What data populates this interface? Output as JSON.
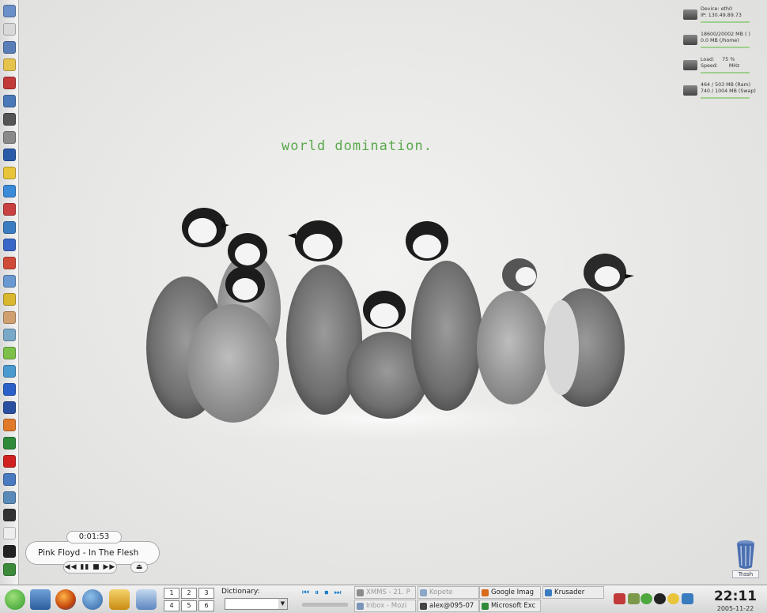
{
  "desktop": {
    "tagline": "world domination.",
    "trash_label": "Trash"
  },
  "sysmon": [
    {
      "icon": "network-card-icon",
      "text": "Device: eth0\nIP: 130.49.89.73"
    },
    {
      "icon": "hard-disk-icon",
      "text": "18600/20002 MB ( )\n0.0 MB (/home)"
    },
    {
      "icon": "cpu-icon",
      "text": "Load:     75 %\nSpeed:       MHz"
    },
    {
      "icon": "memory-icon",
      "text": "464 / 503 MB (Ram)\n740 / 1004 MB (Swap)"
    }
  ],
  "left_launcher_icons": [
    "filemanager-icon",
    "drive-icon",
    "terminal-icon",
    "folder-icon",
    "undo-icon",
    "calendar-icon",
    "printer-icon",
    "editor-icon",
    "network-icon",
    "light-bulb-icon",
    "shield-icon",
    "chart-icon",
    "globe-icon",
    "crossing-icon",
    "pdf-icon",
    "search-icon",
    "sun-icon",
    "clock-icon",
    "paint-icon",
    "palette-icon",
    "gears-icon",
    "cross-icon",
    "word-icon",
    "presentation-icon",
    "spreadsheet-icon",
    "chili-icon",
    "chat-icon",
    "monitor-icon",
    "x-icon",
    "document-icon",
    "spade-icon",
    "down-arrow-icon"
  ],
  "player": {
    "time": "0:01:53",
    "track": "Pink Floyd - In The Flesh",
    "controls": "◀◀ ▮▮ ■ ▶▶",
    "eject": "⏏"
  },
  "taskbar": {
    "pager": [
      "1",
      "2",
      "3",
      "4",
      "5",
      "6"
    ],
    "dictionary_label": "Dictionary:",
    "dictionary_value": "",
    "xmms_buttons": "⏮ ⏸ ⏹ ⏭",
    "tasks": [
      {
        "label": "XMMS - 21. P",
        "dim": true,
        "color": "#8c8c8c"
      },
      {
        "label": "Kopete",
        "dim": true,
        "color": "#8aa6c8"
      },
      {
        "label": "Google Imag",
        "dim": false,
        "color": "#d86a1a"
      },
      {
        "label": "Krusader",
        "dim": false,
        "color": "#3a7cc0"
      },
      {
        "label": "Inbox - Mozi",
        "dim": true,
        "color": "#7a95b8"
      },
      {
        "label": "alex@095-07",
        "dim": false,
        "color": "#444444"
      },
      {
        "label": "Microsoft Exc",
        "dim": false,
        "color": "#2f8a3a"
      }
    ],
    "clock_time": "22:11",
    "clock_date": "2005-11-22"
  },
  "colors": {
    "tagline": "#5aa84c",
    "accent": "#1e7ec8"
  }
}
